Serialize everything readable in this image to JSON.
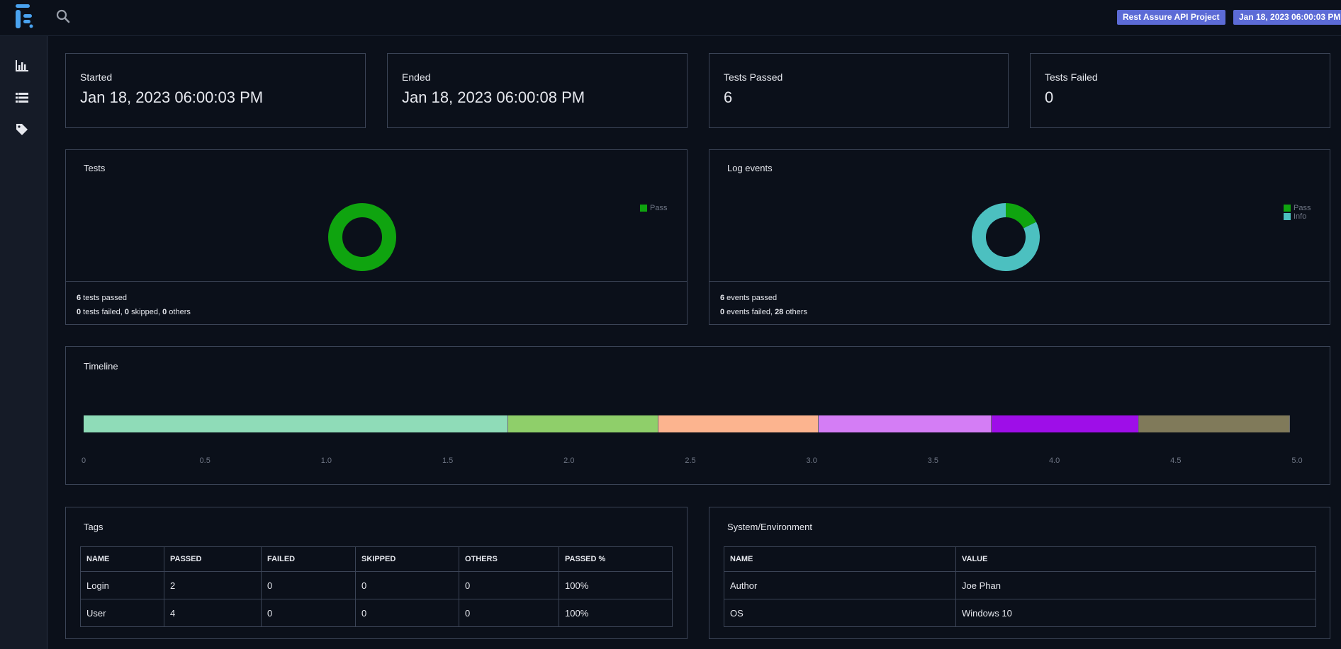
{
  "header": {
    "project_badge": "Rest Assure API Project",
    "date_badge": "Jan 18, 2023 06:00:03 PM",
    "icons": [
      "logo-icon",
      "search-icon"
    ]
  },
  "sidebar": {
    "items": [
      {
        "icon": "bar-chart-icon"
      },
      {
        "icon": "list-icon"
      },
      {
        "icon": "tag-icon"
      }
    ]
  },
  "stats": [
    {
      "label": "Started",
      "value": "Jan 18, 2023 06:00:03 PM"
    },
    {
      "label": "Ended",
      "value": "Jan 18, 2023 06:00:08 PM"
    },
    {
      "label": "Tests Passed",
      "value": "6"
    },
    {
      "label": "Tests Failed",
      "value": "0"
    }
  ],
  "tests_card": {
    "title": "Tests",
    "legend": [
      "Pass"
    ],
    "footer": {
      "passed": "6",
      "passed_text": " tests passed",
      "failed": "0",
      "failed_text": " tests failed, ",
      "skipped": "0",
      "skipped_text": " skipped, ",
      "others": "0",
      "others_text": " others"
    }
  },
  "log_card": {
    "title": "Log events",
    "legend": [
      "Pass",
      "Info"
    ],
    "footer": {
      "passed": "6",
      "passed_text": " events passed",
      "failed": "0",
      "failed_text": " events failed, ",
      "others": "28",
      "others_text": " others"
    }
  },
  "colors": {
    "pass": "#0fa40f",
    "info": "#4cc0c0",
    "badge": "#5c6bd6"
  },
  "chart_data": [
    {
      "type": "pie",
      "name": "Tests",
      "categories": [
        "Pass"
      ],
      "values": [
        6
      ],
      "colors": [
        "#0fa40f"
      ],
      "legend": "top-right"
    },
    {
      "type": "pie",
      "name": "Log events",
      "categories": [
        "Pass",
        "Info"
      ],
      "values": [
        6,
        28
      ],
      "colors": [
        "#0fa40f",
        "#4cc0c0"
      ],
      "legend": "top-right"
    },
    {
      "type": "bar",
      "name": "Timeline",
      "title": "Timeline",
      "orientation": "horizontal-stacked",
      "segments": [
        {
          "start": 0,
          "end": 1.75,
          "color": "#8fdcb8"
        },
        {
          "start": 1.75,
          "end": 2.37,
          "color": "#8fcf6a"
        },
        {
          "start": 2.37,
          "end": 3.03,
          "color": "#fcb48f"
        },
        {
          "start": 3.03,
          "end": 3.74,
          "color": "#d47df5"
        },
        {
          "start": 3.74,
          "end": 4.35,
          "color": "#9e0ee8"
        },
        {
          "start": 4.35,
          "end": 4.97,
          "color": "#807a5a"
        }
      ],
      "xlim": [
        0,
        5
      ],
      "ticks": [
        "0",
        "0.5",
        "1.0",
        "1.5",
        "2.0",
        "2.5",
        "3.0",
        "3.5",
        "4.0",
        "4.5",
        "5.0"
      ]
    }
  ],
  "tags_card": {
    "title": "Tags",
    "columns": [
      "NAME",
      "PASSED",
      "FAILED",
      "SKIPPED",
      "OTHERS",
      "PASSED %"
    ],
    "rows": [
      [
        "Login",
        "2",
        "0",
        "0",
        "0",
        "100%"
      ],
      [
        "User",
        "4",
        "0",
        "0",
        "0",
        "100%"
      ]
    ]
  },
  "env_card": {
    "title": "System/Environment",
    "columns": [
      "NAME",
      "VALUE"
    ],
    "rows": [
      [
        "Author",
        "Joe Phan"
      ],
      [
        "OS",
        "Windows 10"
      ]
    ]
  }
}
